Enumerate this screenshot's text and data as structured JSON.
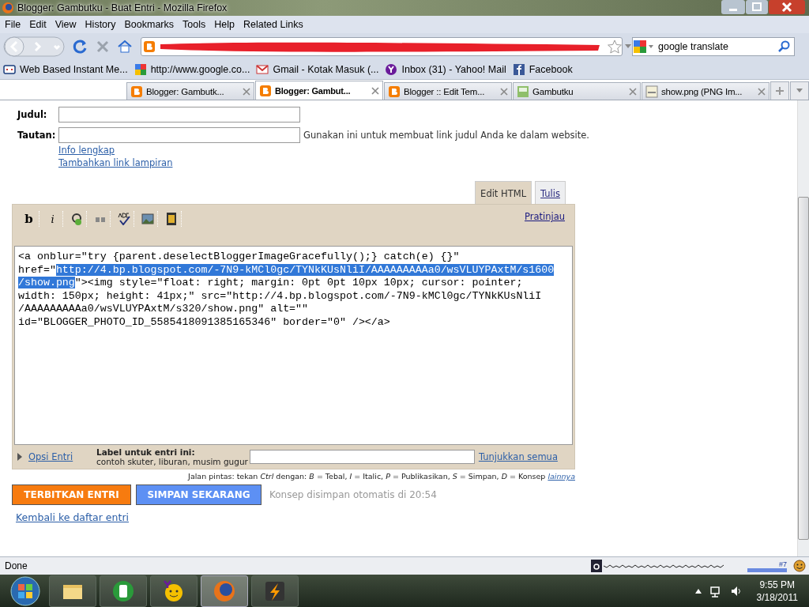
{
  "window": {
    "title": "Blogger: Gambutku - Buat Entri - Mozilla Firefox"
  },
  "menu": [
    {
      "label": "File"
    },
    {
      "label": "Edit"
    },
    {
      "label": "View"
    },
    {
      "label": "History"
    },
    {
      "label": "Bookmarks"
    },
    {
      "label": "Tools"
    },
    {
      "label": "Help"
    },
    {
      "label": "Related Links"
    }
  ],
  "search": {
    "value": "google translate"
  },
  "bookmarks": [
    {
      "label": "Web Based Instant Me...",
      "kind": "chat"
    },
    {
      "label": "http://www.google.co...",
      "kind": "google"
    },
    {
      "label": "Gmail - Kotak Masuk (...",
      "kind": "mail"
    },
    {
      "label": "Inbox (31) - Yahoo! Mail",
      "kind": "yahoo"
    },
    {
      "label": "Facebook",
      "kind": "facebook"
    }
  ],
  "tabs": [
    {
      "label": "Blogger: Gambutk...",
      "kind": "blogger",
      "selected": false
    },
    {
      "label": "Blogger: Gambut...",
      "kind": "blogger",
      "selected": true
    },
    {
      "label": "Blogger :: Edit Tem...",
      "kind": "blogger",
      "selected": false
    },
    {
      "label": "Gambutku",
      "kind": "page",
      "selected": false
    },
    {
      "label": "show.png (PNG Im...",
      "kind": "image",
      "selected": false
    }
  ],
  "form": {
    "title_label": "Judul:",
    "link_label": "Tautan:",
    "link_hint": "Gunakan ini untuk membuat link judul Anda ke dalam website.",
    "info_link": "Info lengkap",
    "attach_link": "Tambahkan link lampiran"
  },
  "editor": {
    "modes": [
      {
        "label": "Edit HTML",
        "selected": true
      },
      {
        "label": "Tulis",
        "selected": false
      }
    ],
    "toolbar": [
      {
        "kind": "bold",
        "label": "b"
      },
      {
        "kind": "italic",
        "label": "i"
      },
      {
        "kind": "link"
      },
      {
        "kind": "quote"
      },
      {
        "kind": "spellcheck"
      },
      {
        "kind": "image"
      },
      {
        "kind": "video"
      }
    ],
    "preview": "Pratinjau",
    "code_lines": [
      [
        {
          "text": "<a onblur=\"try {parent.deselectBloggerImageGracefully();} catch(e) {}\"",
          "selected": false
        }
      ],
      [
        {
          "text": "href=\"",
          "selected": false
        },
        {
          "text": "http://4.bp.blogspot.com/-7N9-kMCl0gc/TYNkKUsNliI/AAAAAAAAAa0/wsVLUYPAxtM/s1600",
          "selected": true
        }
      ],
      [
        {
          "text": "/show.png",
          "selected": true
        },
        {
          "text": "\"><img style=\"float: right; margin: 0pt 0pt 10px 10px; cursor: pointer;",
          "selected": false
        }
      ],
      [
        {
          "text": "width: 150px; height: 41px;\" src=\"http://4.bp.blogspot.com/-7N9-kMCl0gc/TYNkKUsNliI",
          "selected": false
        }
      ],
      [
        {
          "text": "/AAAAAAAAAa0/wsVLUYPAxtM/s320/show.png\" alt=\"\"",
          "selected": false
        }
      ],
      [
        {
          "text": "id=\"BLOGGER_PHOTO_ID_5585418091385165346\" border=\"0\" /></a>",
          "selected": false
        }
      ]
    ]
  },
  "options": {
    "toggle": "Opsi Entri",
    "label_title": "Label untuk entri ini:",
    "label_hint": "contoh skuter, liburan, musim gugur",
    "show_all": "Tunjukkan semua"
  },
  "shortcuts": {
    "text": "Jalan pintas: tekan *Ctrl* dengan: *B* = Tebal, *I* = Italic, *P* = Publikasikan, *S* = Simpan, *D* = Konsep",
    "more": "lainnya"
  },
  "actions": {
    "publish": "TERBITKAN ENTRI",
    "save": "SIMPAN SEKARANG",
    "autosave": "Konsep disimpan otomatis di 20:54",
    "back": "Kembali ke daftar entri"
  },
  "status_bar": {
    "text": "Done",
    "badge": "#7"
  },
  "taskbar": {
    "apps": [
      {
        "kind": "folder",
        "selected": false
      },
      {
        "kind": "phone",
        "selected": false
      },
      {
        "kind": "messenger",
        "selected": false
      },
      {
        "kind": "firefox",
        "selected": true
      },
      {
        "kind": "player",
        "selected": false
      }
    ],
    "time": "9:55 PM",
    "date": "3/18/2011"
  }
}
